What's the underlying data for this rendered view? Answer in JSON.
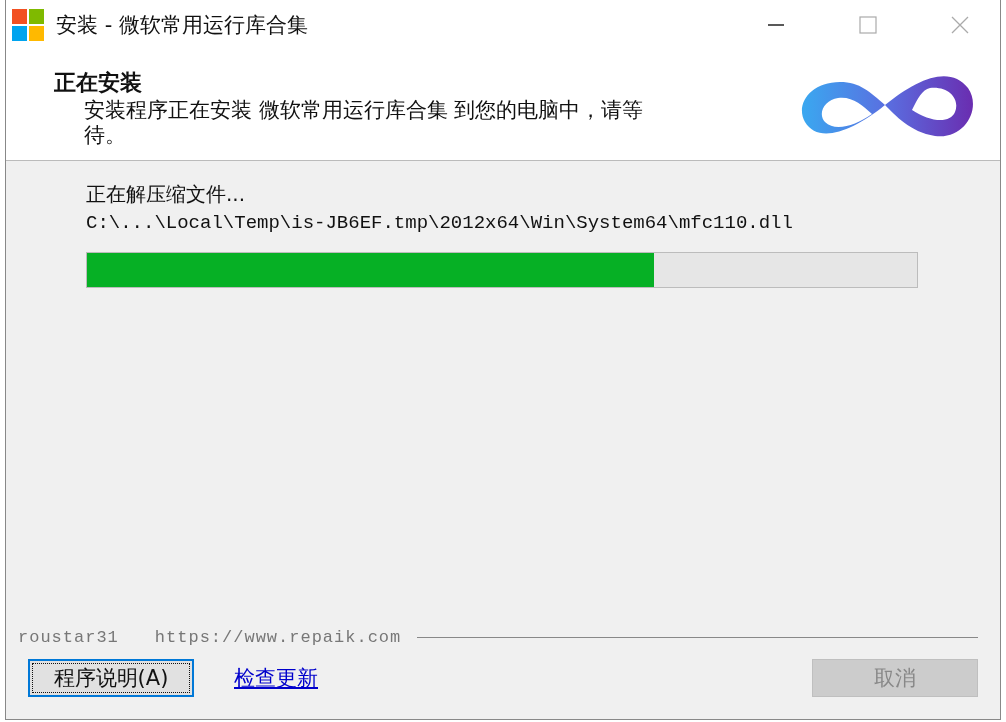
{
  "window": {
    "title": "安装 - 微软常用运行库合集"
  },
  "header": {
    "title": "正在安装",
    "description": "安装程序正在安装 微软常用运行库合集 到您的电脑中，请等待。"
  },
  "status": {
    "message": "正在解压缩文件...",
    "file_path": "C:\\...\\Local\\Temp\\is-JB6EF.tmp\\2012x64\\Win\\System64\\mfc110.dll"
  },
  "progress": {
    "level": 0.683
  },
  "branding": {
    "author": "roustar31",
    "url": "https://www.repaik.com"
  },
  "buttons": [
    {
      "kind": "button",
      "label": "程序说明(A)",
      "focused": true,
      "disabled": false
    },
    {
      "kind": "link",
      "label": "检查更新",
      "focused": false,
      "disabled": false
    },
    {
      "kind": "button",
      "label": "取消",
      "focused": false,
      "disabled": true
    }
  ]
}
